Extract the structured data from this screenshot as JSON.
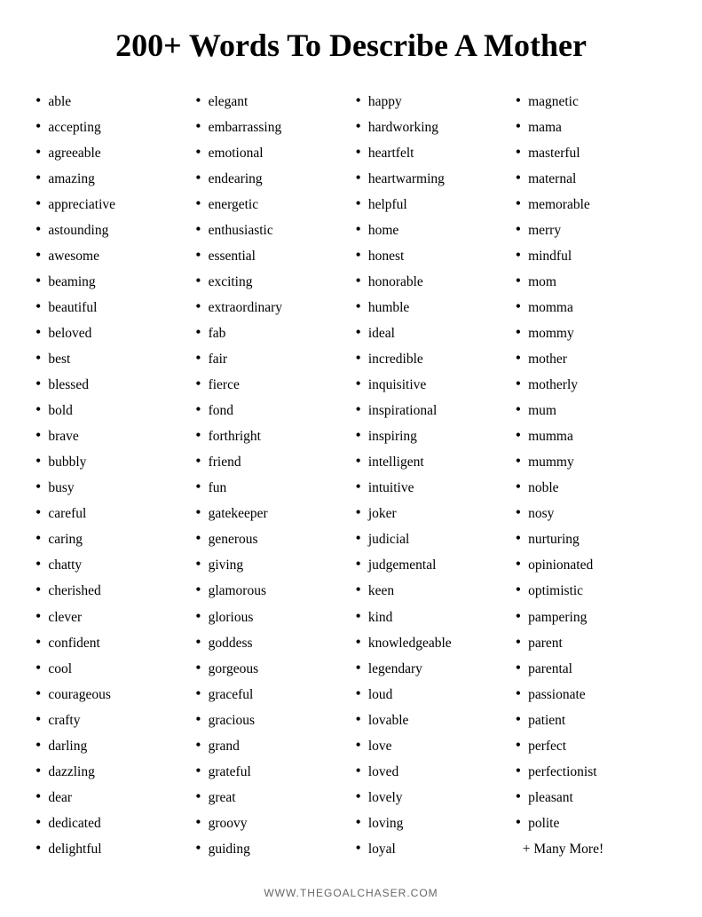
{
  "title": "200+ Words To Describe A Mother",
  "columns": [
    {
      "id": "col1",
      "words": [
        "able",
        "accepting",
        "agreeable",
        "amazing",
        "appreciative",
        "astounding",
        "awesome",
        "beaming",
        "beautiful",
        "beloved",
        "best",
        "blessed",
        "bold",
        "brave",
        "bubbly",
        "busy",
        "careful",
        "caring",
        "chatty",
        "cherished",
        "clever",
        "confident",
        "cool",
        "courageous",
        "crafty",
        "darling",
        "dazzling",
        "dear",
        "dedicated",
        "delightful"
      ]
    },
    {
      "id": "col2",
      "words": [
        "elegant",
        "embarrassing",
        "emotional",
        "endearing",
        "energetic",
        "enthusiastic",
        "essential",
        "exciting",
        "extraordinary",
        "fab",
        "fair",
        "fierce",
        "fond",
        "forthright",
        "friend",
        "fun",
        "gatekeeper",
        "generous",
        "giving",
        "glamorous",
        "glorious",
        "goddess",
        "gorgeous",
        "graceful",
        "gracious",
        "grand",
        "grateful",
        "great",
        "groovy",
        "guiding"
      ]
    },
    {
      "id": "col3",
      "words": [
        "happy",
        "hardworking",
        "heartfelt",
        "heartwarming",
        "helpful",
        "home",
        "honest",
        "honorable",
        "humble",
        " ideal",
        "incredible",
        "inquisitive",
        "inspirational",
        "inspiring",
        "intelligent",
        "intuitive",
        "joker",
        "judicial",
        "judgemental",
        "keen",
        "kind",
        "knowledgeable",
        "legendary",
        "loud",
        "lovable",
        "love",
        "loved",
        "lovely",
        "loving",
        "loyal"
      ]
    },
    {
      "id": "col4",
      "words": [
        "magnetic",
        "mama",
        "masterful",
        "maternal",
        "memorable",
        "merry",
        "mindful",
        "mom",
        "momma",
        "mommy",
        "mother",
        "motherly",
        "mum",
        "mumma",
        "mummy",
        "noble",
        "nosy",
        "nurturing",
        "opinionated",
        "optimistic",
        "pampering",
        "parent",
        "parental",
        "passionate",
        "patient",
        "perfect",
        "perfectionist",
        "pleasant",
        "polite"
      ],
      "extra": "+ Many More!"
    }
  ],
  "footer": "WWW.THEGOALCHASER.COM",
  "bullet": "•"
}
